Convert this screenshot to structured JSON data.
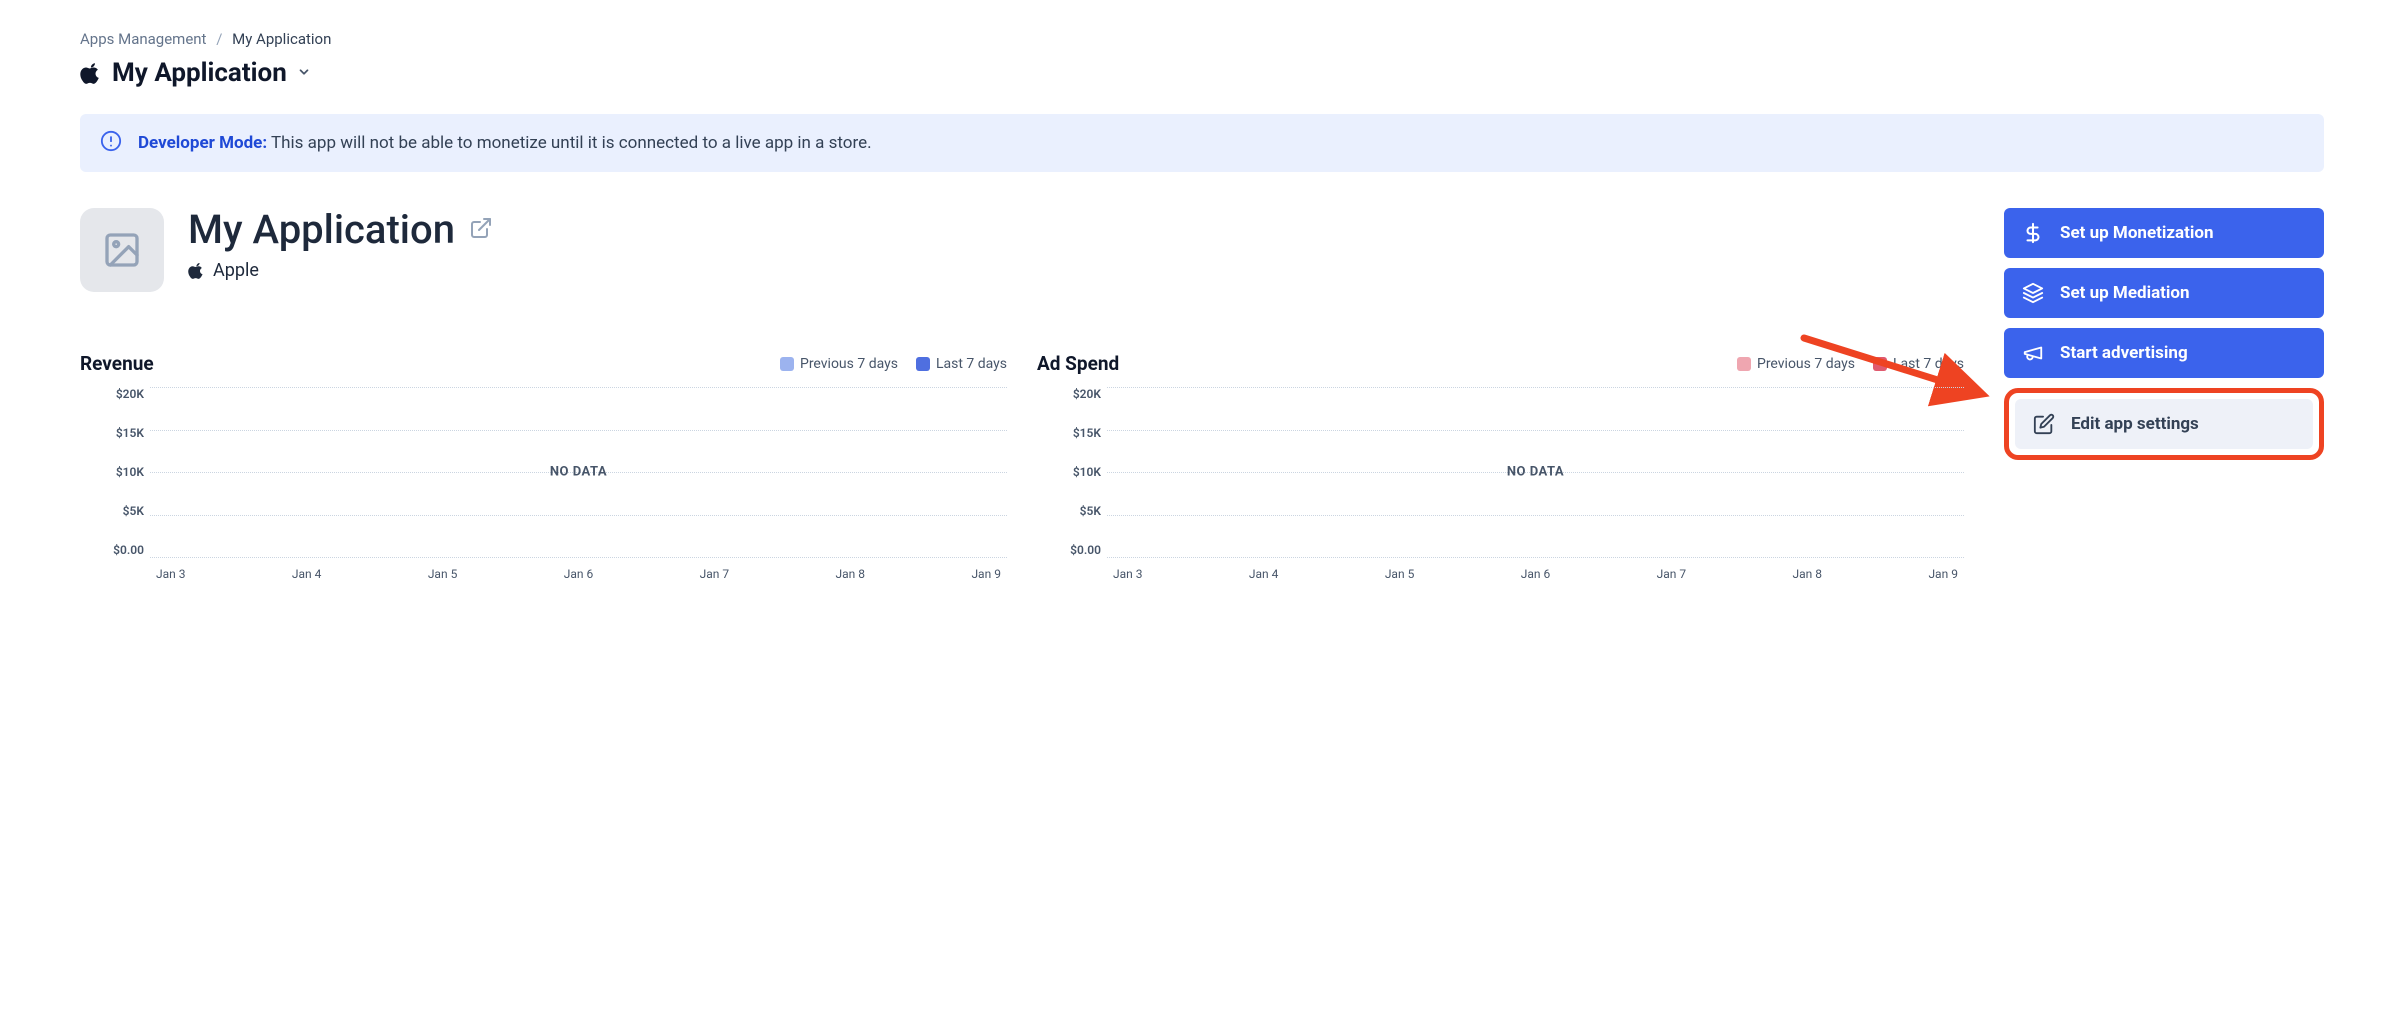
{
  "breadcrumb": {
    "root": "Apps Management",
    "current": "My Application"
  },
  "app_selector": {
    "name": "My Application"
  },
  "banner": {
    "prefix": "Developer Mode:",
    "text": "This app will not be able to monetize until it is connected to a live app in a store."
  },
  "app": {
    "title": "My Application",
    "platform": "Apple"
  },
  "actions": {
    "monetization": "Set up Monetization",
    "mediation": "Set up Mediation",
    "advertising": "Start advertising",
    "edit": "Edit app settings"
  },
  "charts": {
    "revenue": {
      "title": "Revenue",
      "legend_prev": "Previous 7 days",
      "legend_last": "Last 7 days",
      "color_prev": "#9cb3ef",
      "color_last": "#4f6fe0",
      "no_data": "NO DATA"
    },
    "adspend": {
      "title": "Ad Spend",
      "legend_prev": "Previous 7 days",
      "legend_last": "Last 7 days",
      "color_prev": "#efa6b0",
      "color_last": "#e05a6e",
      "no_data": "NO DATA"
    }
  },
  "chart_data": [
    {
      "type": "line",
      "title": "Revenue",
      "categories": [
        "Jan 3",
        "Jan 4",
        "Jan 5",
        "Jan 6",
        "Jan 7",
        "Jan 8",
        "Jan 9"
      ],
      "series": [
        {
          "name": "Previous 7 days",
          "values": [
            null,
            null,
            null,
            null,
            null,
            null,
            null
          ]
        },
        {
          "name": "Last 7 days",
          "values": [
            null,
            null,
            null,
            null,
            null,
            null,
            null
          ]
        }
      ],
      "ylabel": "",
      "ylim": [
        0,
        20000
      ],
      "yticks": [
        "$20K",
        "$15K",
        "$10K",
        "$5K",
        "$0.00"
      ],
      "no_data": true
    },
    {
      "type": "line",
      "title": "Ad Spend",
      "categories": [
        "Jan 3",
        "Jan 4",
        "Jan 5",
        "Jan 6",
        "Jan 7",
        "Jan 8",
        "Jan 9"
      ],
      "series": [
        {
          "name": "Previous 7 days",
          "values": [
            null,
            null,
            null,
            null,
            null,
            null,
            null
          ]
        },
        {
          "name": "Last 7 days",
          "values": [
            null,
            null,
            null,
            null,
            null,
            null,
            null
          ]
        }
      ],
      "ylabel": "",
      "ylim": [
        0,
        20000
      ],
      "yticks": [
        "$20K",
        "$15K",
        "$10K",
        "$5K",
        "$0.00"
      ],
      "no_data": true
    }
  ]
}
